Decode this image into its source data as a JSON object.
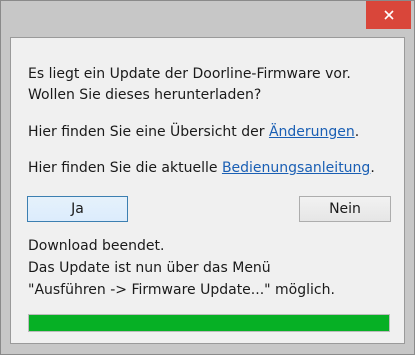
{
  "dialog": {
    "message_line1": "Es liegt ein Update der Doorline-Firmware vor.",
    "message_line2": "Wollen Sie dieses herunterladen?",
    "changes_prefix": "Hier finden Sie eine Übersicht der ",
    "changes_link": "Änderungen",
    "changes_suffix": ".",
    "manual_prefix": "Hier finden Sie die aktuelle ",
    "manual_link": "Bedienungsanleitung",
    "manual_suffix": ".",
    "yes_label": "Ja",
    "no_label": "Nein",
    "status_line1": "Download beendet.",
    "status_line2": "Das Update ist nun über das Menü",
    "status_line3": "\"Ausführen -> Firmware Update...\" möglich.",
    "progress_percent": 100
  },
  "titlebar": {
    "close_icon": "close-icon"
  },
  "colors": {
    "close_button": "#d9463a",
    "link": "#1a5fb4",
    "progress_fill": "#06b025"
  }
}
